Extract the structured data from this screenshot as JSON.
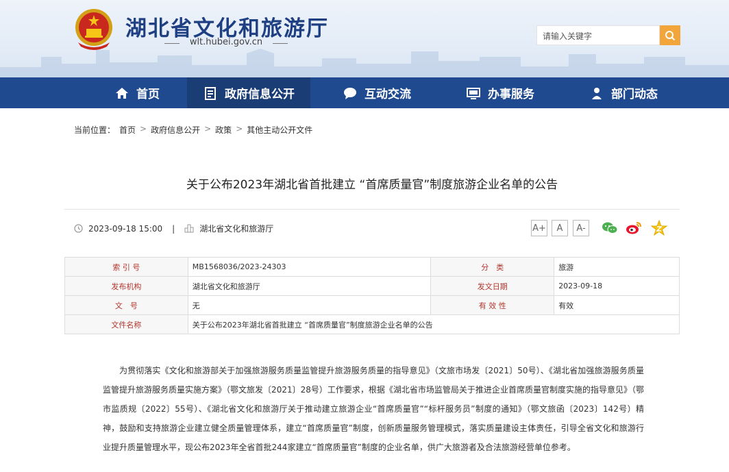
{
  "header": {
    "site_title": "湖北省文化和旅游厅",
    "site_domain": "wlt.hubei.gov.cn",
    "search_placeholder": "请输入关键字"
  },
  "nav": {
    "items": [
      {
        "label": "首页",
        "icon": "home-icon"
      },
      {
        "label": "政府信息公开",
        "icon": "document-icon"
      },
      {
        "label": "互动交流",
        "icon": "chat-bubble-icon"
      },
      {
        "label": "办事服务",
        "icon": "monitor-icon"
      },
      {
        "label": "部门动态",
        "icon": "person-icon"
      }
    ],
    "active": "政府信息公开",
    "colors": {
      "bar": "#1f4a8f",
      "active": "#1a3d76"
    }
  },
  "breadcrumb": {
    "prefix": "当前位置：",
    "items": [
      "首页",
      "政府信息公开",
      "政策",
      "其他主动公开文件"
    ],
    "separator": ">"
  },
  "article": {
    "title": "关于公布2023年湖北省首批建立 “首席质量官”制度旅游企业名单的公告",
    "date": "2023-09-18 15:00",
    "divider": "|",
    "source": "湖北省文化和旅游厅",
    "font_sizes": [
      "A+",
      "A",
      "A-"
    ],
    "share_icons": [
      "wechat-icon",
      "weibo-icon",
      "favorite-star-icon"
    ]
  },
  "info_table": {
    "rows": [
      {
        "l1": "索 引 号",
        "v1": "MB1568036/2023-24303",
        "l2": "分　类",
        "v2": "旅游"
      },
      {
        "l1": "发布机构",
        "v1": "湖北省文化和旅游厅",
        "l2": "发文日期",
        "v2": "2023-09-18"
      },
      {
        "l1": "文　号",
        "v1": "无",
        "l2": "有 效 性",
        "v2": "有效"
      }
    ],
    "last_row": {
      "l1": "文件名称",
      "v1": "关于公布2023年湖北省首批建立 “首席质量官”制度旅游企业名单的公告"
    }
  },
  "body": {
    "paragraph": "为贯彻落实《文化和旅游部关于加强旅游服务质量监管提升旅游服务质量的指导意见》（文旅市场发〔2021〕50号）、《湖北省加强旅游服务质量监管提升旅游服务质量实施方案》（鄂文旅发〔2021〕28号）工作要求，根据《湖北省市场监管局关于推进企业首席质量官制度实施的指导意见》（鄂市监质规〔2022〕55号）、《湖北省文化和旅游厅关于推动建立旅游企业“首席质量官”“标杆服务员”制度的通知》（鄂文旅函〔2023〕142号）精神，鼓励和支持旅游企业建立健全质量管理体系，建立“首席质量官”制度，创新质量服务管理模式，落实质量建设主体责任，引导全省文化和旅游行业提升质量管理水平，现公布2023年全省首批244家建立“首席质量官”制度的企业名单，供广大旅游者及合法旅游经营单位参考。"
  }
}
